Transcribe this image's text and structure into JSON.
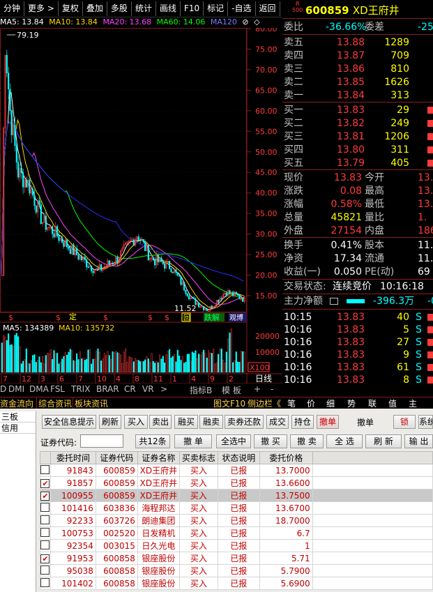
{
  "toolbar": [
    "分钟",
    "更多 >",
    "复权",
    "叠加",
    "多股",
    "统计",
    "画线",
    "F10",
    "标记",
    "-自选",
    "返回"
  ],
  "ma": {
    "ma5": "MA5: 13.84",
    "ma10": "MA10: 13.84",
    "ma20": "MA20: 13.68",
    "ma60": "MA60: 14.06",
    "ma120": "MA120"
  },
  "price_axis": [
    "80.00",
    "75.00",
    "70.00",
    "65.00",
    "60.00",
    "55.00",
    "50.00",
    "45.00",
    "40.00",
    "35.00",
    "30.00",
    "25.00",
    "20.00",
    "15.00"
  ],
  "price_high": "79.19",
  "price_low": "11.52",
  "markers": {
    "ding": "定",
    "die": "跌解",
    "guan": "观博",
    "hui": "回"
  },
  "vol_legend": {
    "ma5": "MA5: 134389",
    "ma10": "MA10: 135732"
  },
  "vol_axis": [
    "20000",
    "10000",
    "X100"
  ],
  "month_axis": [
    "7",
    "12",
    "3",
    "6",
    "7",
    "10",
    "4",
    "8",
    "11",
    "1",
    "4",
    "9",
    "2"
  ],
  "rixian": "日线",
  "indicator_tabs": [
    "D",
    "DMI",
    "DMA",
    "FSL",
    "TRIX",
    "BRAR",
    "CR",
    "VR",
    ">",
    "指标B",
    "模 板",
    "+",
    "-"
  ],
  "news_tabs": [
    "资金流向",
    "综合资讯",
    "板块资讯"
  ],
  "f10_link": "图文F10",
  "sidebar_toggle": "侧边栏《",
  "right_tabs": [
    "笔",
    "价",
    "细",
    "势",
    "联",
    "值",
    "主"
  ],
  "stock": {
    "code": "600859",
    "name": "XD王府井",
    "badge_top": "R",
    "badge_bottom": "500"
  },
  "ratio": {
    "label1": "委比",
    "value1": "-36.66%",
    "label2": "委差",
    "value2": "-25"
  },
  "asks": [
    {
      "label": "卖五",
      "price": "13.88",
      "vol": "1289"
    },
    {
      "label": "卖四",
      "price": "13.87",
      "vol": "709"
    },
    {
      "label": "卖三",
      "price": "13.86",
      "vol": "810"
    },
    {
      "label": "卖二",
      "price": "13.85",
      "vol": "1626"
    },
    {
      "label": "卖一",
      "price": "13.84",
      "vol": "313"
    }
  ],
  "bids": [
    {
      "label": "买一",
      "price": "13.83",
      "vol": "29"
    },
    {
      "label": "买二",
      "price": "13.82",
      "vol": "249"
    },
    {
      "label": "买三",
      "price": "13.81",
      "vol": "1206"
    },
    {
      "label": "买四",
      "price": "13.80",
      "vol": "311"
    },
    {
      "label": "买五",
      "price": "13.79",
      "vol": "405"
    }
  ],
  "quote": [
    {
      "l1": "现价",
      "v1": "13.83",
      "l2": "今开",
      "v2": "13."
    },
    {
      "l1": "涨跌",
      "v1": "0.08",
      "l2": "最高",
      "v2": "13."
    },
    {
      "l1": "涨幅",
      "v1": "0.58%",
      "l2": "最低",
      "v2": "13."
    },
    {
      "l1": "总量",
      "v1": "45821",
      "l2": "量比",
      "v2": "1."
    },
    {
      "l1": "外盘",
      "v1": "27154",
      "l2": "内盘",
      "v2": "186"
    }
  ],
  "fund": [
    {
      "l1": "换手",
      "v1": "0.41%",
      "l2": "股本",
      "v2": "11.2"
    },
    {
      "l1": "净资",
      "v1": "17.34",
      "l2": "流通",
      "v2": "11.2"
    },
    {
      "l1": "收益(一)",
      "v1": "0.050",
      "l2": "PE(动)",
      "v2": "69"
    }
  ],
  "trade_status": {
    "label": "交易状态:",
    "value": "连续竞价",
    "time": "10:16:18"
  },
  "main_flow": {
    "label": "主力净额",
    "value": "-396.3万",
    "tail": "-0"
  },
  "ticks": [
    {
      "time": "10:15",
      "price": "13.83",
      "vol": "40",
      "bs": "S"
    },
    {
      "time": "10:16",
      "price": "13.83",
      "vol": "5",
      "bs": "S"
    },
    {
      "time": "10:16",
      "price": "13.83",
      "vol": "27",
      "bs": "S"
    },
    {
      "time": "10:16",
      "price": "13.83",
      "vol": "9",
      "bs": "S"
    },
    {
      "time": "10:16",
      "price": "13.83",
      "vol": "61",
      "bs": "S"
    },
    {
      "time": "10:16",
      "price": "13.83",
      "vol": "8",
      "bs": "S"
    }
  ],
  "left_nav": [
    "三板",
    "信用"
  ],
  "action_buttons": [
    "安全信息提示",
    "刷新",
    "买入",
    "卖出",
    "融买",
    "融卖",
    "卖券还款",
    "成交",
    "持仓",
    "撤单",
    "撤单",
    "锁",
    "系统"
  ],
  "filter": {
    "label": "证券代码:",
    "value": "",
    "count": "共12条",
    "cancel": "撤 单",
    "select_all": "全选中",
    "cancel_buy": "撤 买",
    "cancel_sell": "撤 卖",
    "all": "全 选",
    "refresh": "刷 新",
    "export": "输 出"
  },
  "columns": [
    "委托时间",
    "证券代码",
    "证券名称",
    "买卖标志",
    "状态说明",
    "委托价格",
    ""
  ],
  "orders": [
    {
      "checked": false,
      "time": "91843",
      "code": "600859",
      "name": "XD王府井",
      "side": "买入",
      "status": "已报",
      "price": "13.7000",
      "selected": false
    },
    {
      "checked": true,
      "time": "91857",
      "code": "600859",
      "name": "XD王府井",
      "side": "买入",
      "status": "已报",
      "price": "13.6600",
      "selected": false
    },
    {
      "checked": true,
      "time": "100955",
      "code": "600859",
      "name": "XD王府井",
      "side": "买入",
      "status": "已报",
      "price": "13.7500",
      "selected": true
    },
    {
      "checked": false,
      "time": "101416",
      "code": "603836",
      "name": "海程邦达",
      "side": "买入",
      "status": "已报",
      "price": "13.6700",
      "selected": false
    },
    {
      "checked": false,
      "time": "92233",
      "code": "603726",
      "name": "朗迪集团",
      "side": "买入",
      "status": "已报",
      "price": "18.7000",
      "selected": false
    },
    {
      "checked": false,
      "time": "100753",
      "code": "002520",
      "name": "日发精机",
      "side": "买入",
      "status": "已报",
      "price": "6.7",
      "selected": false
    },
    {
      "checked": false,
      "time": "92354",
      "code": "003015",
      "name": "日久光电",
      "side": "买入",
      "status": "已报",
      "price": "1",
      "selected": false
    },
    {
      "checked": true,
      "time": "91953",
      "code": "600858",
      "name": "银座股份",
      "side": "买入",
      "status": "已报",
      "price": "5.71",
      "selected": false
    },
    {
      "checked": false,
      "time": "95038",
      "code": "600858",
      "name": "银座股份",
      "side": "买入",
      "status": "已报",
      "price": "5.7900",
      "selected": false
    },
    {
      "checked": false,
      "time": "101402",
      "code": "600858",
      "name": "银座股份",
      "side": "买入",
      "status": "已报",
      "price": "5.6900",
      "selected": false
    }
  ],
  "colors": {
    "up": "#ff3c3c",
    "down": "#00ffff",
    "yellow": "#ffff00",
    "ma10": "#ffd700",
    "ma20": "#ff44ff",
    "ma60": "#00ff00",
    "ma120": "#2c2cff"
  }
}
